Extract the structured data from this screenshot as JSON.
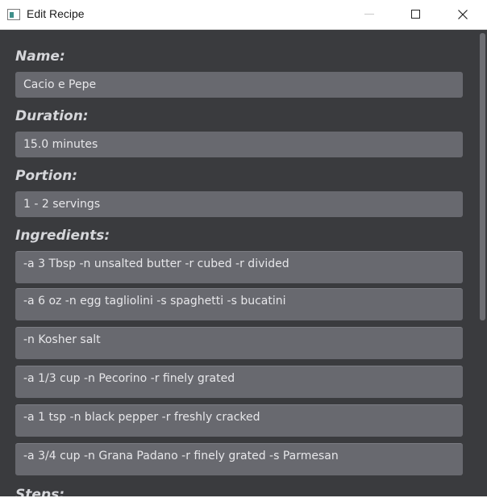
{
  "window": {
    "title": "Edit Recipe"
  },
  "form": {
    "name": {
      "label": "Name:",
      "value": "Cacio e Pepe"
    },
    "duration": {
      "label": "Duration:",
      "value": "15.0 minutes"
    },
    "portion": {
      "label": "Portion:",
      "value": "1 - 2 servings"
    },
    "ingredients": {
      "label": "Ingredients:",
      "items": [
        "-a 3 Tbsp -n unsalted butter -r cubed -r divided",
        "-a 6 oz -n egg tagliolini -s spaghetti -s bucatini",
        "-n Kosher salt",
        "-a 1/3 cup -n Pecorino -r finely grated",
        "-a 1 tsp -n black pepper -r freshly cracked",
        "-a 3/4 cup -n Grana Padano -r finely grated -s Parmesan"
      ]
    },
    "steps": {
      "label": "Steps:"
    }
  },
  "icons": {
    "app": "app-window-icon",
    "minimize": "minimize-icon",
    "maximize": "maximize-icon",
    "close": "close-icon"
  },
  "colors": {
    "background": "#3a3b3e",
    "field": "#68696f",
    "label": "#d5d6da",
    "text": "#e7e7ea"
  }
}
